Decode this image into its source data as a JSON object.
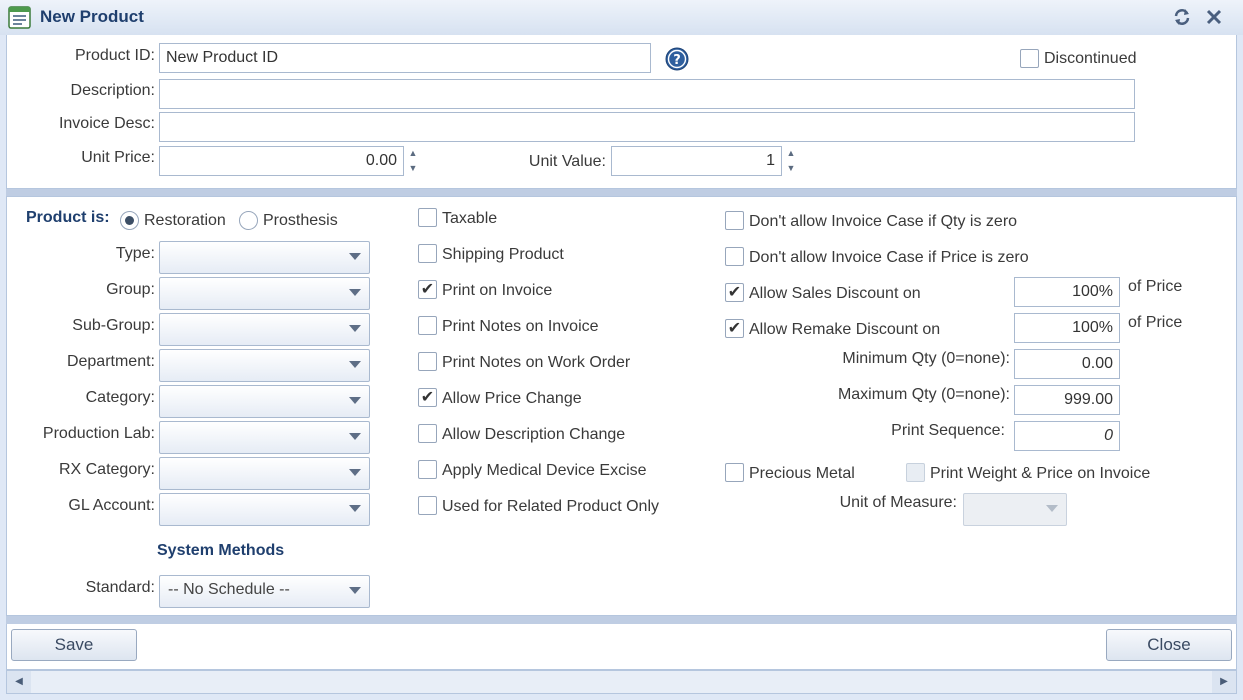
{
  "window": {
    "title": "New Product",
    "refresh_icon": "refresh-icon",
    "close_icon": "close-icon"
  },
  "top": {
    "product_id_label": "Product ID:",
    "product_id_value": "New Product ID",
    "help_icon": "help-icon",
    "discontinued_label": "Discontinued",
    "description_label": "Description:",
    "description_value": "",
    "invoice_desc_label": "Invoice Desc:",
    "invoice_desc_value": "",
    "unit_price_label": "Unit Price:",
    "unit_price_value": "0.00",
    "unit_value_label": "Unit Value:",
    "unit_value_value": "1"
  },
  "product_is": {
    "label": "Product is:",
    "options": [
      "Restoration",
      "Prosthesis"
    ],
    "selected": "Restoration"
  },
  "fields": {
    "type_label": "Type:",
    "group_label": "Group:",
    "subgroup_label": "Sub-Group:",
    "department_label": "Department:",
    "category_label": "Category:",
    "production_lab_label": "Production Lab:",
    "rx_category_label": "RX Category:",
    "gl_account_label": "GL Account:"
  },
  "system_methods": {
    "title": "System Methods",
    "standard_label": "Standard:",
    "standard_value": "-- No Schedule --"
  },
  "checks_mid": [
    {
      "label": "Taxable",
      "checked": false
    },
    {
      "label": "Shipping Product",
      "checked": false
    },
    {
      "label": "Print on Invoice",
      "checked": true
    },
    {
      "label": "Print Notes on Invoice",
      "checked": false
    },
    {
      "label": "Print Notes on Work Order",
      "checked": false
    },
    {
      "label": "Allow Price Change",
      "checked": true
    },
    {
      "label": "Allow Description Change",
      "checked": false
    },
    {
      "label": "Apply Medical Device Excise",
      "checked": false
    },
    {
      "label": "Used for Related Product Only",
      "checked": false
    }
  ],
  "right": {
    "no_invoice_qty_zero": {
      "label": "Don't allow Invoice Case if Qty is zero",
      "checked": false
    },
    "no_invoice_price_zero": {
      "label": "Don't allow Invoice Case if Price is zero",
      "checked": false
    },
    "allow_sales_discount": {
      "label": "Allow Sales Discount on",
      "checked": true,
      "value": "100%"
    },
    "allow_remake_discount": {
      "label": "Allow Remake Discount on",
      "checked": true,
      "value": "100%"
    },
    "of_price_label": "of Price",
    "min_qty_label": "Minimum Qty (0=none):",
    "min_qty_value": "0.00",
    "max_qty_label": "Maximum Qty (0=none):",
    "max_qty_value": "999.00",
    "print_sequence_label": "Print Sequence:",
    "print_sequence_value": "0",
    "precious_metal": {
      "label": "Precious Metal",
      "checked": false
    },
    "print_weight": {
      "label": "Print Weight & Price on Invoice",
      "checked": false,
      "disabled": true
    },
    "unit_of_measure_label": "Unit of Measure:",
    "unit_of_measure_value": ""
  },
  "footer": {
    "save_label": "Save",
    "close_label": "Close"
  },
  "check_glyph": "✔"
}
